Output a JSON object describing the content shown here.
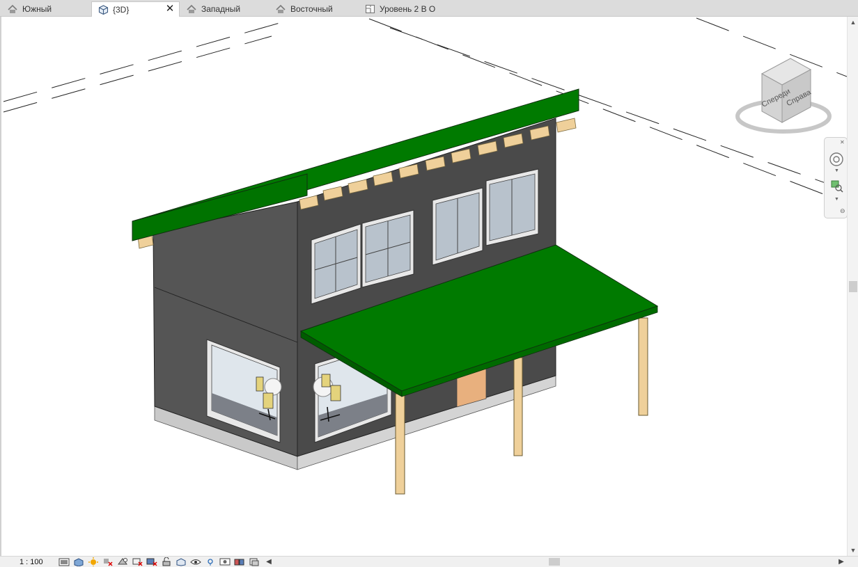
{
  "tabs": [
    {
      "label": "Южный",
      "icon": "elevation-icon",
      "active": false
    },
    {
      "label": "{3D}",
      "icon": "cube-3d-icon",
      "active": true
    },
    {
      "label": "Западный",
      "icon": "elevation-icon",
      "active": false
    },
    {
      "label": "Восточный",
      "icon": "elevation-icon",
      "active": false
    },
    {
      "label": "Уровень 2 В О",
      "icon": "floor-plan-icon",
      "active": false
    }
  ],
  "close_symbol": "✕",
  "viewcube": {
    "front_label": "Спереди",
    "right_label": "Справа"
  },
  "status": {
    "scale": "1 : 100"
  },
  "colors": {
    "roof": "#007a00",
    "wall": "#4a4a4a",
    "glass": "#b8c2cc",
    "wood": "#efd09a",
    "foundation": "#c9c9c9",
    "door": "#e8b07e"
  },
  "statusbar_icons": [
    "detail-level-icon",
    "visual-style-icon",
    "sun-path-icon",
    "shadows-icon",
    "render-icon",
    "crop-view-icon",
    "show-crop-icon",
    "unlock-3d-icon",
    "temporary-hide-icon",
    "reveal-hidden-icon",
    "worksharing-icon",
    "temporary-view-properties-icon",
    "analytical-model-icon",
    "highlight-displacement-icon",
    "constraints-icon"
  ]
}
